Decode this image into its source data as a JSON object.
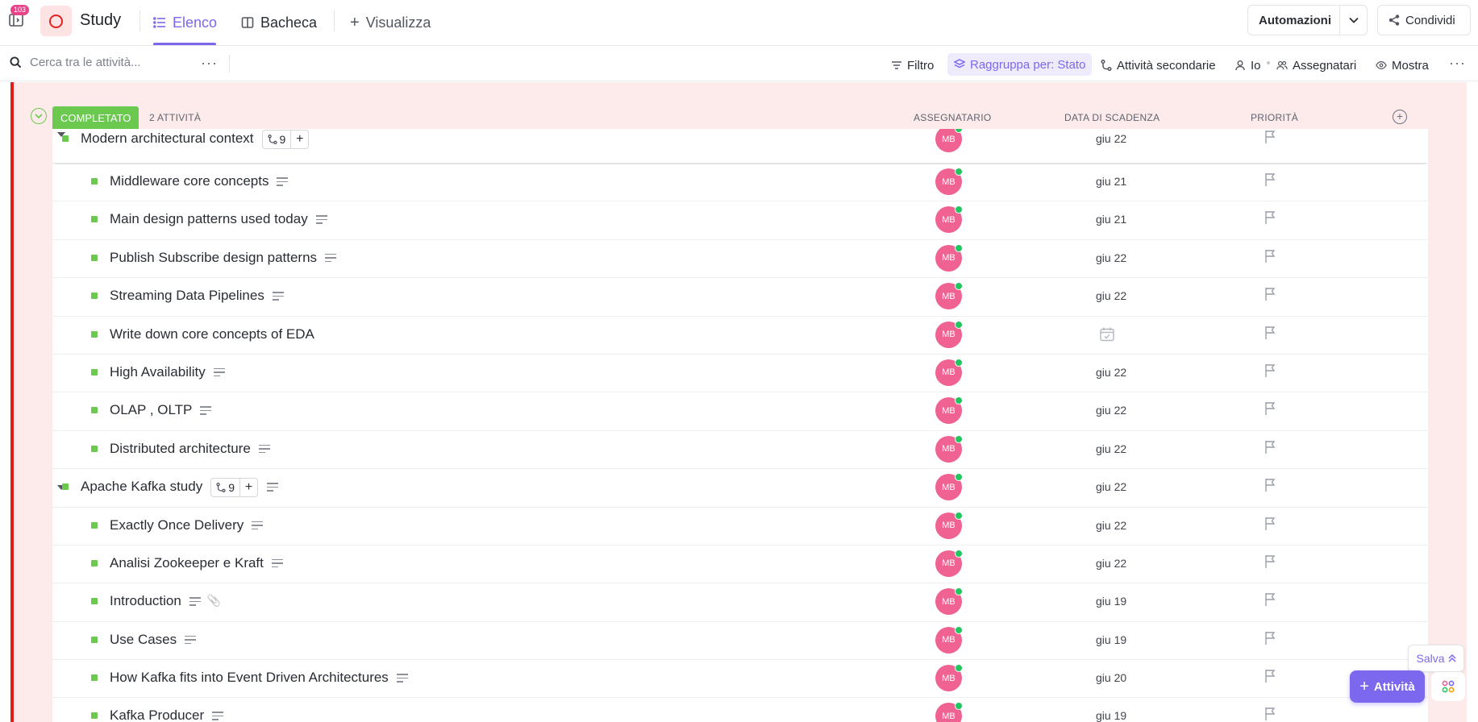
{
  "topbar": {
    "notif_count": "103",
    "space_title": "Study",
    "tabs": [
      {
        "label": "Elenco",
        "icon": "list-icon",
        "active": true
      },
      {
        "label": "Bacheca",
        "icon": "board-icon",
        "active": false
      }
    ],
    "add_view_label": "Visualizza",
    "automations_label": "Automazioni",
    "share_label": "Condividi"
  },
  "toolbar": {
    "search_placeholder": "Cerca tra le attività...",
    "filter_label": "Filtro",
    "group_label": "Raggruppa per: Stato",
    "subtasks_label": "Attività secondarie",
    "me_label": "Io",
    "assignees_label": "Assegnatari",
    "show_label": "Mostra"
  },
  "group": {
    "status": "COMPLETATO",
    "status_color": "#6bc950",
    "count": "2 ATTIVITÀ",
    "col_assignee": "ASSEGNATARIO",
    "col_due": "DATA DI SCADENZA",
    "col_priority": "PRIORITÀ"
  },
  "tasks": [
    {
      "name": "Modern architectural context",
      "level": 0,
      "subtasks": "9",
      "assignee": "MB",
      "due": "giu 22",
      "desc": false
    },
    {
      "name": "Middleware core concepts",
      "level": 1,
      "assignee": "MB",
      "due": "giu 21",
      "desc": true
    },
    {
      "name": "Main design patterns used today",
      "level": 1,
      "assignee": "MB",
      "due": "giu 21",
      "desc": true
    },
    {
      "name": "Publish Subscribe design patterns",
      "level": 1,
      "assignee": "MB",
      "due": "giu 22",
      "desc": true
    },
    {
      "name": "Streaming Data Pipelines",
      "level": 1,
      "assignee": "MB",
      "due": "giu 22",
      "desc": true
    },
    {
      "name": "Write down core concepts of EDA",
      "level": 1,
      "assignee": "MB",
      "due": "",
      "desc": false
    },
    {
      "name": "High Availability",
      "level": 1,
      "assignee": "MB",
      "due": "giu 22",
      "desc": true
    },
    {
      "name": "OLAP , OLTP",
      "level": 1,
      "assignee": "MB",
      "due": "giu 22",
      "desc": true
    },
    {
      "name": "Distributed architecture",
      "level": 1,
      "assignee": "MB",
      "due": "giu 22",
      "desc": true
    },
    {
      "name": "Apache Kafka study",
      "level": 0,
      "subtasks": "9",
      "assignee": "MB",
      "due": "giu 22",
      "desc": true
    },
    {
      "name": "Exactly Once Delivery",
      "level": 1,
      "assignee": "MB",
      "due": "giu 22",
      "desc": true
    },
    {
      "name": "Analisi Zookeeper e Kraft",
      "level": 1,
      "assignee": "MB",
      "due": "giu 22",
      "desc": true
    },
    {
      "name": "Introduction",
      "level": 1,
      "assignee": "MB",
      "due": "giu 19",
      "desc": true,
      "attachment": true
    },
    {
      "name": "Use Cases",
      "level": 1,
      "assignee": "MB",
      "due": "giu 19",
      "desc": true
    },
    {
      "name": "How Kafka fits into Event Driven Architectures",
      "level": 1,
      "assignee": "MB",
      "due": "giu 20",
      "desc": true
    },
    {
      "name": "Kafka Producer",
      "level": 1,
      "assignee": "MB",
      "due": "giu 19",
      "desc": true
    }
  ],
  "floating": {
    "save_label": "Salva",
    "new_task_label": "Attività"
  }
}
